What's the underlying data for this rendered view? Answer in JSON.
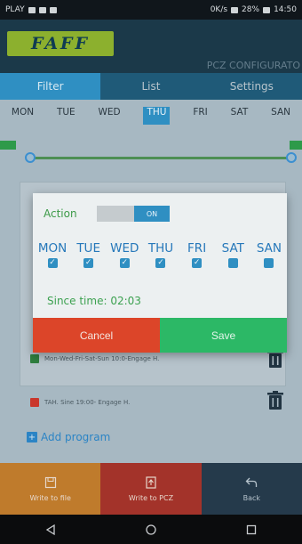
{
  "status_bar": {
    "left_text": "PLAY",
    "right_text": "0K/s",
    "battery": "28%",
    "time": "14:50"
  },
  "header": {
    "logo_text": "FAFF",
    "title": "PCZ CONFIGURATO"
  },
  "tabs": [
    {
      "label": "Filter",
      "active": true
    },
    {
      "label": "List",
      "active": false
    },
    {
      "label": "Settings",
      "active": false
    }
  ],
  "day_row": [
    "MON",
    "TUE",
    "WED",
    "THU",
    "FRI",
    "SAT",
    "SAN"
  ],
  "programs": [
    {
      "text": "Mon-Wed-Fri-Sat-Sun 10:0-Engage H.",
      "color": "green"
    },
    {
      "text": "TAH. Sine 19:00- Engage H.",
      "color": "red"
    }
  ],
  "add_program_label": "Add program",
  "dialog": {
    "action_label": "Action",
    "switch_label": "ON",
    "days": [
      {
        "name": "MON",
        "checked": true
      },
      {
        "name": "TUE",
        "checked": true
      },
      {
        "name": "WED",
        "checked": true
      },
      {
        "name": "THU",
        "checked": true
      },
      {
        "name": "FRI",
        "checked": true
      },
      {
        "name": "SAT",
        "checked": false
      },
      {
        "name": "SAN",
        "checked": false
      }
    ],
    "since_text": "Since time: 02:03",
    "cancel_label": "Cancel",
    "save_label": "Save"
  },
  "toolbar": {
    "write_file_label": "Write to file",
    "write_pcz_label": "Write to PCZ",
    "back_label": "Back"
  },
  "colors": {
    "accent_blue": "#2f8fc2",
    "cancel_red": "#dc4529",
    "save_green": "#2cb866",
    "brand_green": "#8cb02e"
  }
}
